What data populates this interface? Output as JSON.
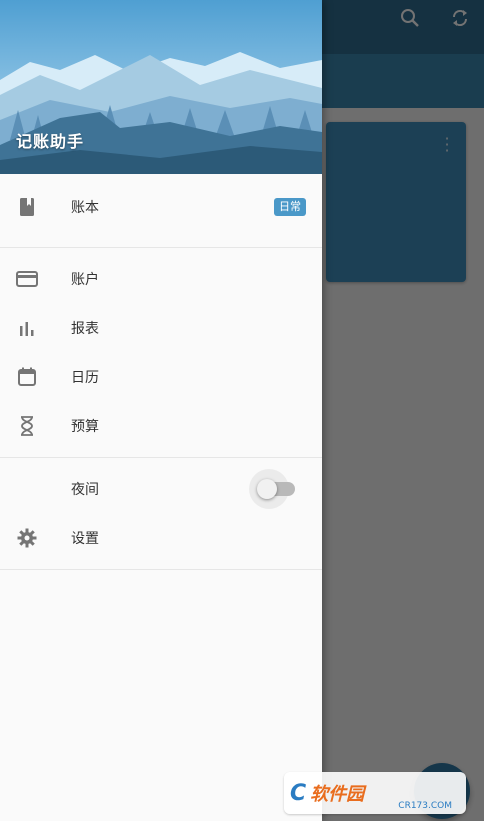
{
  "drawer": {
    "app_name": "记账助手",
    "book": {
      "label": "账本",
      "badge": "日常",
      "icon": "book-icon"
    },
    "items": [
      {
        "label": "账户",
        "icon": "credit-card-icon"
      },
      {
        "label": "报表",
        "icon": "bar-chart-icon"
      },
      {
        "label": "日历",
        "icon": "calendar-icon"
      },
      {
        "label": "预算",
        "icon": "hourglass-icon"
      }
    ],
    "night": {
      "label": "夜间",
      "icon": "moon-icon",
      "enabled": false
    },
    "settings": {
      "label": "设置",
      "icon": "gear-icon"
    }
  },
  "toolbar": {
    "search_icon": "search-icon",
    "sync_icon": "sync-icon"
  },
  "watermark": {
    "brand": "软件园",
    "site": "CR173.COM"
  },
  "colors": {
    "accent": "#2f6e91",
    "badge": "#4a98c8",
    "card": "#3f8fbd"
  }
}
